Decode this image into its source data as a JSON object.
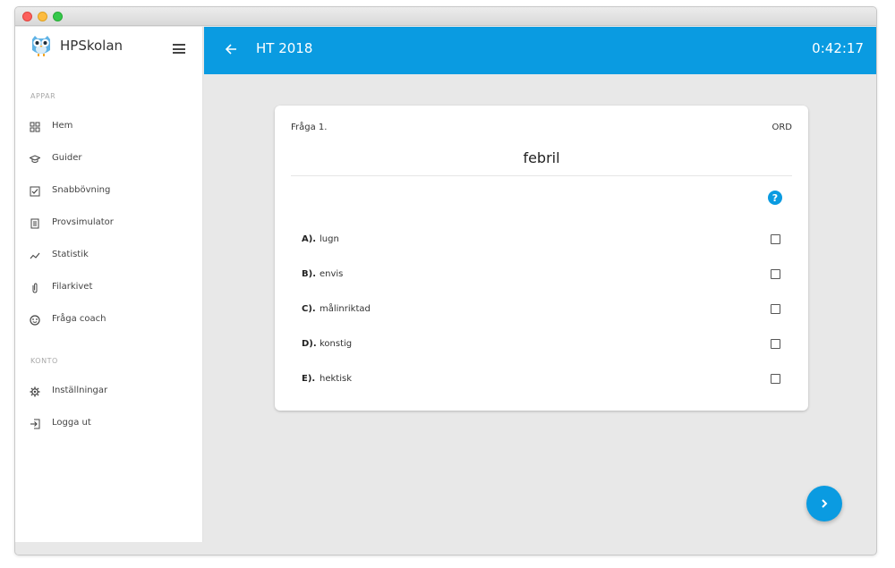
{
  "app": {
    "name": "HPSkolan"
  },
  "sidebar": {
    "section_apps": "APPAR",
    "section_account": "KONTO",
    "apps": [
      {
        "label": "Hem",
        "icon": "grid-icon"
      },
      {
        "label": "Guider",
        "icon": "graduation-cap-icon"
      },
      {
        "label": "Snabbövning",
        "icon": "checkbox-icon"
      },
      {
        "label": "Provsimulator",
        "icon": "document-icon"
      },
      {
        "label": "Statistik",
        "icon": "trend-line-icon"
      },
      {
        "label": "Filarkivet",
        "icon": "paperclip-icon"
      },
      {
        "label": "Fråga coach",
        "icon": "chat-icon"
      }
    ],
    "account": [
      {
        "label": "Inställningar",
        "icon": "gear-icon"
      },
      {
        "label": "Logga ut",
        "icon": "logout-icon"
      }
    ]
  },
  "header": {
    "title": "HT 2018",
    "timer": "0:42:17"
  },
  "question": {
    "number": "Fråga 1.",
    "type": "ORD",
    "word": "febril",
    "options": [
      {
        "letter": "A).",
        "text": "lugn",
        "checked": false
      },
      {
        "letter": "B).",
        "text": "envis",
        "checked": false
      },
      {
        "letter": "C).",
        "text": "målinriktad",
        "checked": false
      },
      {
        "letter": "D).",
        "text": "konstig",
        "checked": false
      },
      {
        "letter": "E).",
        "text": "hektisk",
        "checked": false
      }
    ]
  },
  "colors": {
    "accent": "#0a9be1",
    "background": "#e8e8e8"
  }
}
